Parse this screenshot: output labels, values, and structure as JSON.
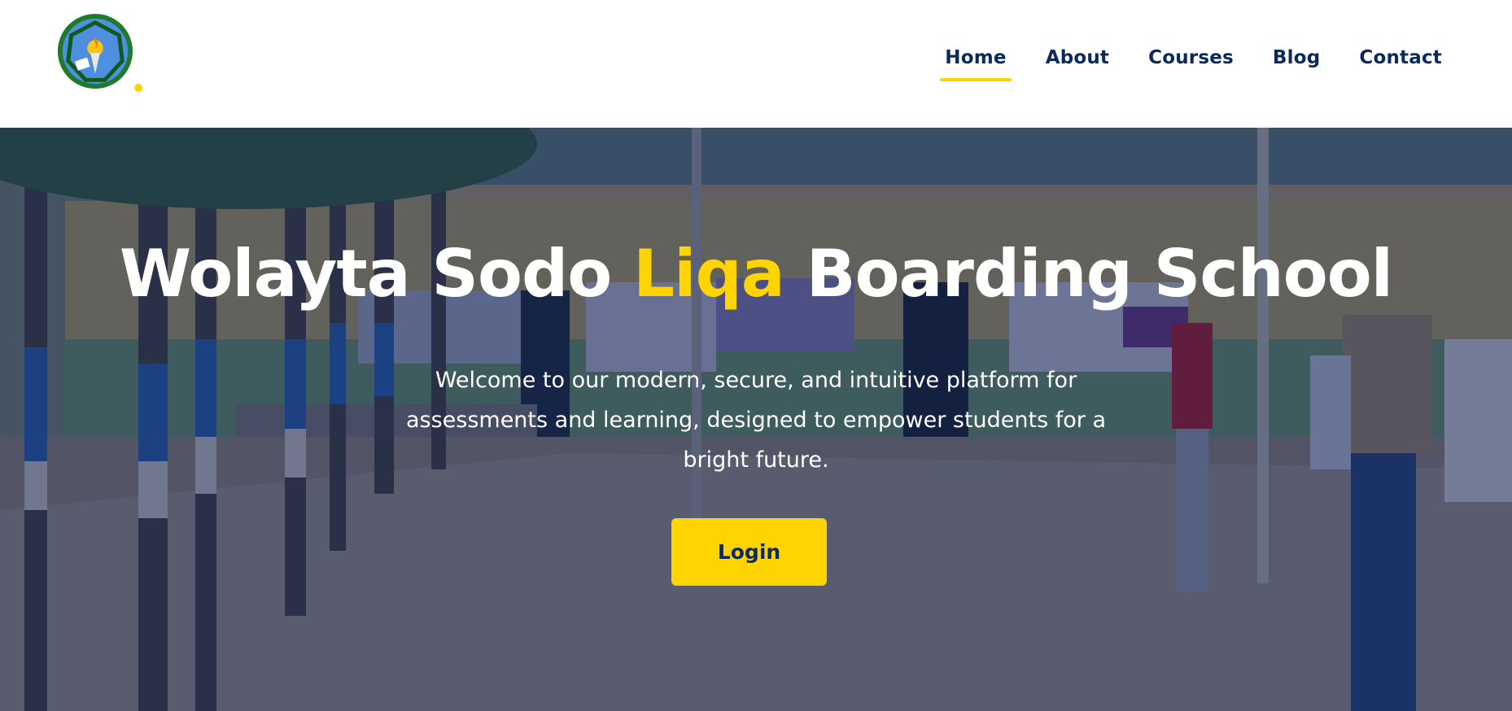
{
  "header": {
    "logo_icon": "school-emblem-icon",
    "nav": [
      {
        "label": "Home",
        "active": true
      },
      {
        "label": "About",
        "active": false
      },
      {
        "label": "Courses",
        "active": false
      },
      {
        "label": "Blog",
        "active": false
      },
      {
        "label": "Contact",
        "active": false
      }
    ]
  },
  "hero": {
    "title_part1": "Wolayta Sodo",
    "title_highlight": "Liqa",
    "title_part2": "Boarding School",
    "subtitle": "Welcome to our modern, secure, and intuitive platform for assessments and learning, designed to empower students for a bright future.",
    "login_label": "Login"
  },
  "colors": {
    "primary": "#0b2a5b",
    "accent": "#ffd400",
    "overlay": "#0c1c4e"
  }
}
